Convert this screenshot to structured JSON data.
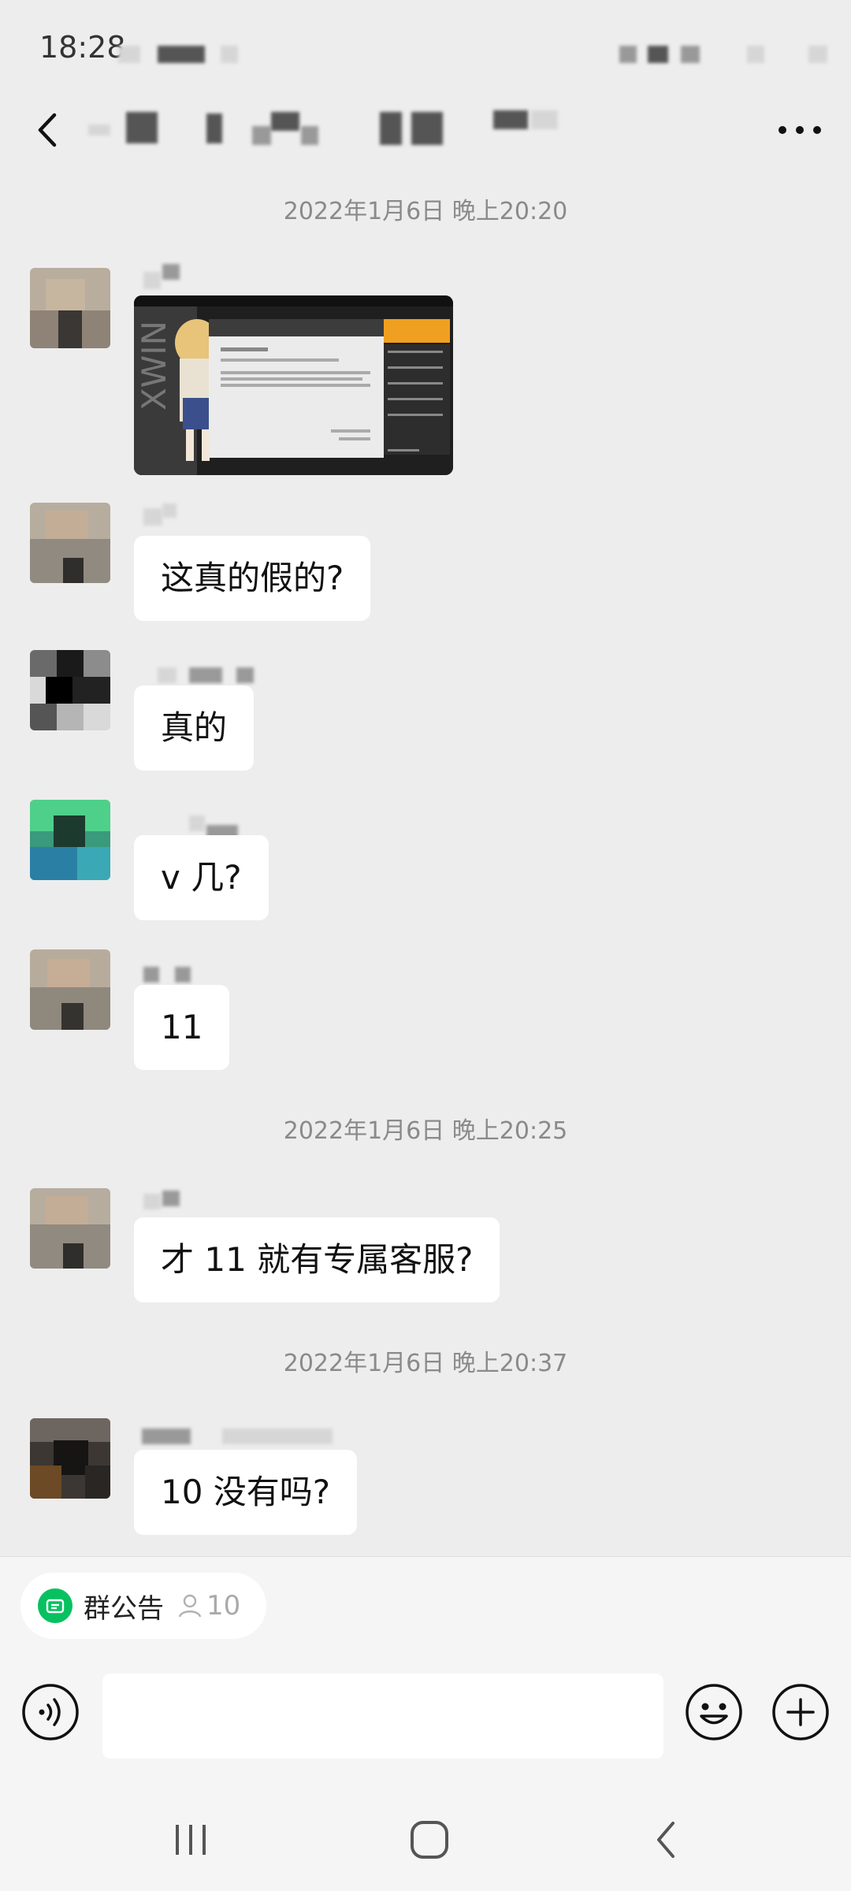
{
  "status_bar": {
    "time": "18:28"
  },
  "header": {
    "title": "",
    "back_icon": "chevron-left-icon",
    "more_icon": "more-dots-icon"
  },
  "messages": [
    {
      "type": "timestamp",
      "text": "2022年1月6日 晚上20:20"
    },
    {
      "type": "image",
      "sender": "",
      "description_icon": "game-screenshot-image"
    },
    {
      "type": "text",
      "sender": "",
      "text": "这真的假的?"
    },
    {
      "type": "text",
      "sender": "",
      "text": "真的"
    },
    {
      "type": "text",
      "sender": "",
      "text": "v 几?"
    },
    {
      "type": "text",
      "sender": "",
      "text": "11"
    },
    {
      "type": "timestamp",
      "text": "2022年1月6日 晚上20:25"
    },
    {
      "type": "text",
      "sender": "",
      "text": "才 11 就有专属客服?"
    },
    {
      "type": "timestamp",
      "text": "2022年1月6日 晚上20:37"
    },
    {
      "type": "text",
      "sender": "",
      "text": "10 没有吗?"
    }
  ],
  "announcement": {
    "label": "群公告",
    "count": "10"
  },
  "input": {
    "placeholder": "",
    "value": ""
  },
  "colors": {
    "background": "#ededed",
    "bubble": "#ffffff",
    "accent": "#07c160"
  }
}
